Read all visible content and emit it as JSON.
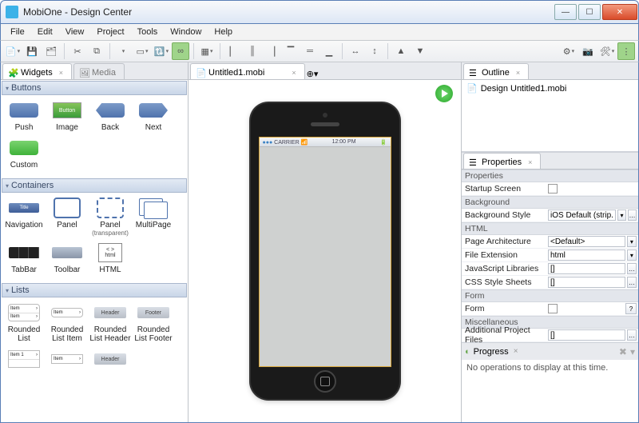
{
  "window": {
    "title": "MobiOne - Design Center"
  },
  "menu": {
    "items": [
      "File",
      "Edit",
      "View",
      "Project",
      "Tools",
      "Window",
      "Help"
    ]
  },
  "left": {
    "tabs": [
      {
        "label": "Widgets"
      },
      {
        "label": "Media"
      }
    ],
    "sections": {
      "buttons": {
        "title": "Buttons",
        "items": [
          "Push",
          "Image",
          "Back",
          "Next",
          "Custom"
        ],
        "imgbtn_text": "Button"
      },
      "containers": {
        "title": "Containers",
        "items": [
          "Navigation",
          "Panel",
          "Panel",
          "MultiPage",
          "TabBar",
          "Toolbar",
          "HTML"
        ],
        "panel_trans_sub": "(transparent)",
        "nav_title": "Title",
        "html_code_top": "< >",
        "html_code_bot": "html"
      },
      "lists": {
        "title": "Lists",
        "items": [
          "Rounded List",
          "Rounded List Item",
          "Rounded List Header",
          "Rounded List Footer"
        ],
        "it": "Item",
        "it1": "Item 1",
        "caret": "›",
        "hdr": "Header",
        "ftr": "Footer"
      }
    }
  },
  "center": {
    "tab_label": "Untitled1.mobi",
    "status": {
      "carrier": "CARRIER",
      "time": "12:00 PM"
    }
  },
  "outline": {
    "title": "Outline",
    "node": "Design Untitled1.mobi"
  },
  "properties": {
    "title": "Properties",
    "groups": {
      "properties": "Properties",
      "background": "Background",
      "html": "HTML",
      "form": "Form",
      "misc": "Miscellaneous"
    },
    "rows": {
      "startup": "Startup Screen",
      "bgstyle": "Background Style",
      "bgstyle_val": "iOS Default (strip...",
      "arch": "Page Architecture",
      "arch_val": "<Default>",
      "ext": "File Extension",
      "ext_val": "html",
      "js": "JavaScript Libraries",
      "js_val": "[]",
      "css": "CSS Style Sheets",
      "css_val": "[]",
      "form": "Form",
      "files": "Additional Project Files",
      "files_val": "[]"
    }
  },
  "progress": {
    "title": "Progress",
    "msg": "No operations to display at this time."
  }
}
